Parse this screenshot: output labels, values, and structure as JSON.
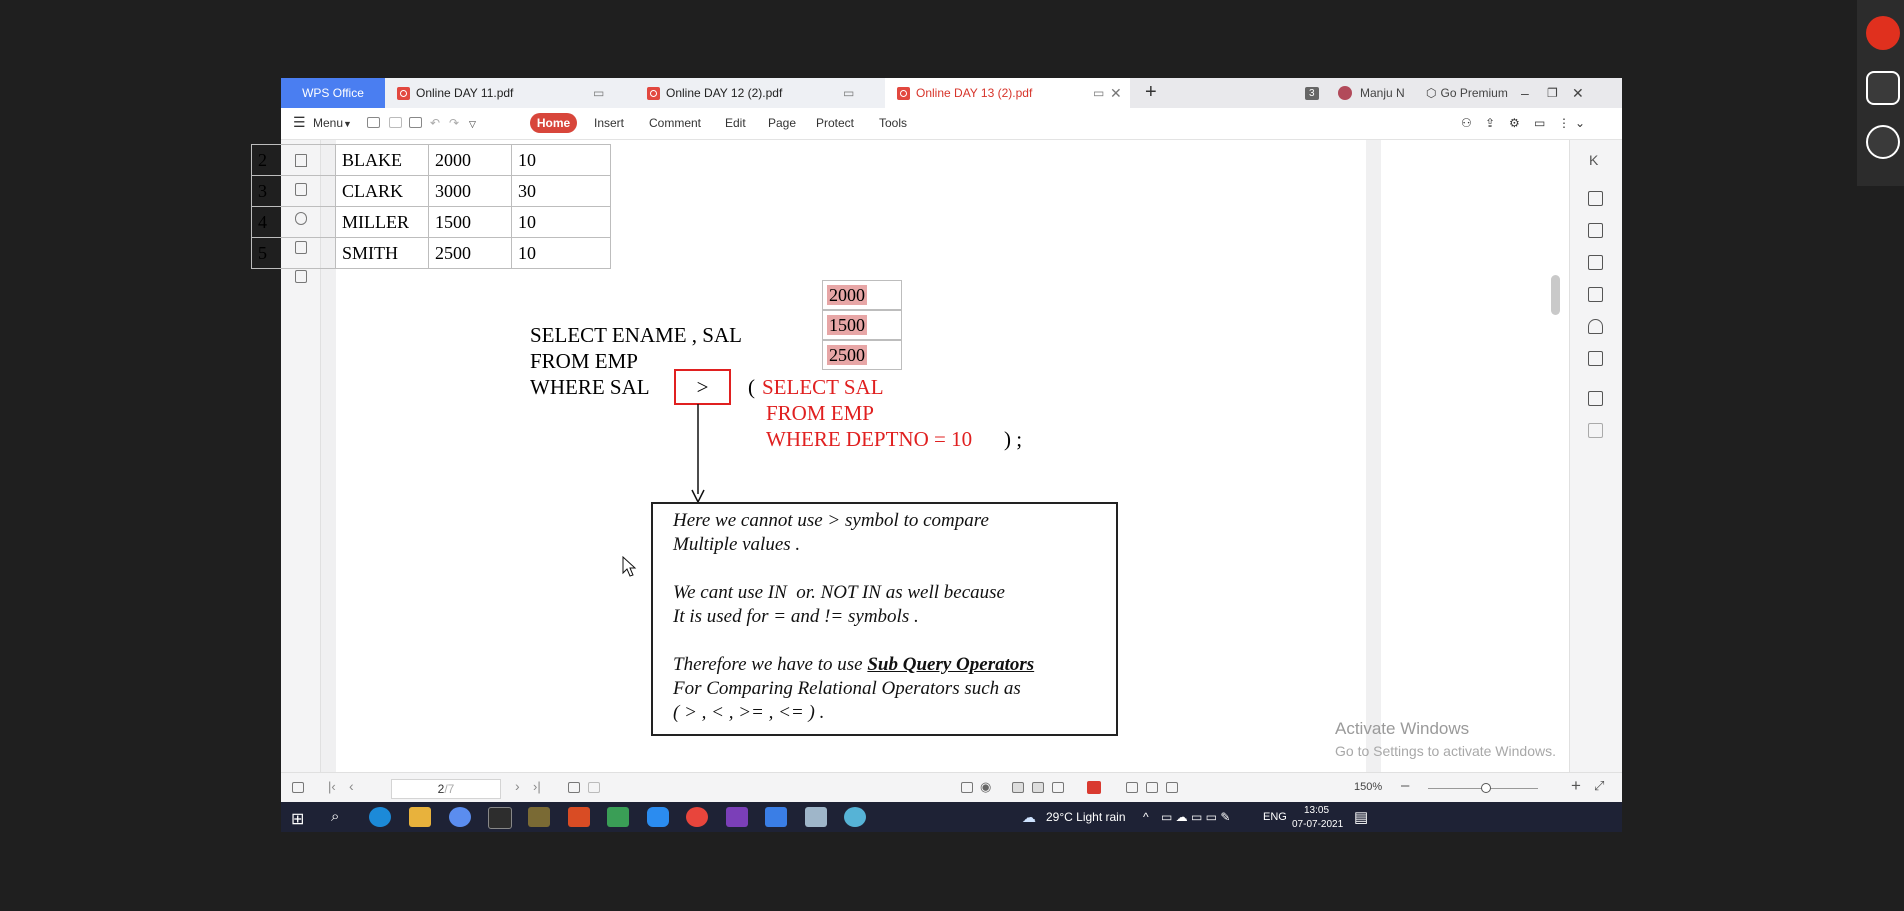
{
  "app": {
    "name": "WPS Office"
  },
  "tabs": [
    {
      "label": "Online DAY 11.pdf"
    },
    {
      "label": "Online DAY 12 (2).pdf"
    },
    {
      "label": "Online DAY 13 (2).pdf"
    }
  ],
  "titlebar": {
    "tab_count": "3",
    "user": "Manju N",
    "premium": "Go Premium"
  },
  "ribbon": {
    "menu": "Menu",
    "items": [
      "Home",
      "Insert",
      "Comment",
      "Edit",
      "Page",
      "Protect",
      "Tools"
    ]
  },
  "document": {
    "table_rows": [
      [
        "2",
        "BLAKE",
        "2000",
        "10"
      ],
      [
        "3",
        "CLARK",
        "3000",
        "30"
      ],
      [
        "4",
        "MILLER",
        "1500",
        "10"
      ],
      [
        "5",
        "SMITH",
        "2500",
        "10"
      ]
    ],
    "sal_values": [
      "2000",
      "1500",
      "2500"
    ],
    "query": {
      "line1": "SELECT ENAME , SAL",
      "line2": "FROM EMP",
      "line3": "WHERE SAL",
      "operator": ">",
      "paren_open": "(",
      "sub1": "SELECT SAL",
      "sub2": "FROM EMP",
      "sub3": "WHERE DEPTNO = 10",
      "sub_end": ") ;"
    },
    "note": {
      "l1": "Here we cannot use > symbol to compare",
      "l2": "Multiple values .",
      "l3": "We cant use IN  or. NOT IN as well because",
      "l4": "It is used for = and != symbols .",
      "l5a": "Therefore we have to use ",
      "l5b": "Sub Query Operators",
      "l6": "For Comparing Relational Operators such as",
      "l7": "( > , < , >= , <= ) ."
    },
    "watermark1": "Activate Windows",
    "watermark2": "Go to Settings to activate Windows."
  },
  "statusbar": {
    "page": "2",
    "total": "/7",
    "zoom": "150%"
  },
  "taskbar": {
    "weather": "29°C  Light rain",
    "lang": "ENG",
    "time": "13:05",
    "date": "07-07-2021"
  }
}
